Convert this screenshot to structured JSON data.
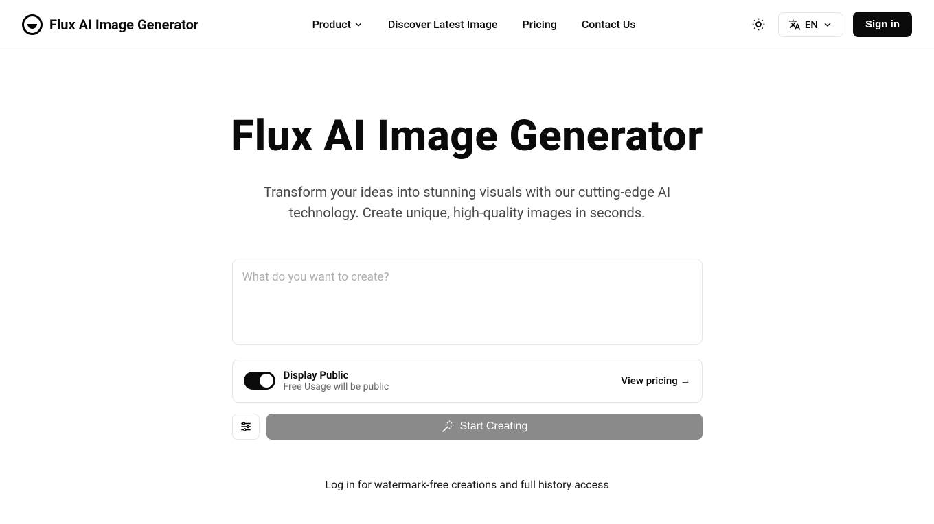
{
  "header": {
    "logo_text": "Flux AI Image Generator",
    "nav": {
      "product": "Product",
      "discover": "Discover Latest Image",
      "pricing": "Pricing",
      "contact": "Contact Us"
    },
    "lang": "EN",
    "signin": "Sign in"
  },
  "hero": {
    "title": "Flux AI Image Generator",
    "subtitle": "Transform your ideas into stunning visuals with our cutting-edge AI technology. Create unique, high-quality images in seconds."
  },
  "generator": {
    "prompt_placeholder": "What do you want to create?",
    "public_title": "Display Public",
    "public_sub": "Free Usage will be public",
    "view_pricing": "View pricing →",
    "start": "Start Creating",
    "login_note": "Log in for watermark-free creations and full history access"
  }
}
